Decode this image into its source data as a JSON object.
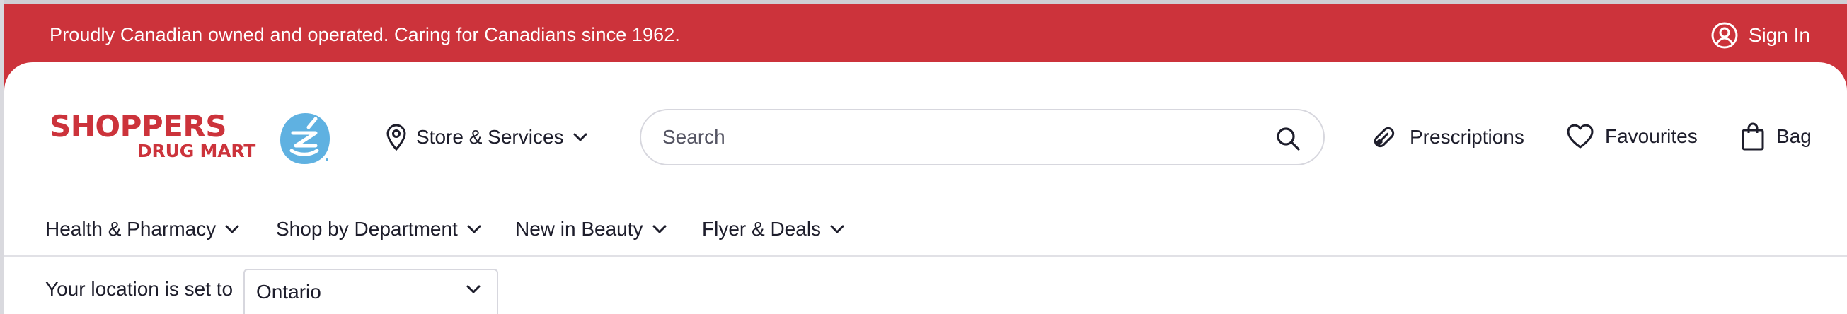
{
  "banner": {
    "message": "Proudly Canadian owned and operated. Caring for Canadians since 1962.",
    "sign_in_label": "Sign In"
  },
  "logo": {
    "line1": "SHOPPERS",
    "line2": "DRUG MART"
  },
  "header": {
    "store_services_label": "Store & Services",
    "search_placeholder": "Search",
    "prescriptions_label": "Prescriptions",
    "favourites_label": "Favourites",
    "bag_label": "Bag"
  },
  "main_nav": {
    "items": [
      {
        "label": "Health & Pharmacy"
      },
      {
        "label": "Shop by Department"
      },
      {
        "label": "New in Beauty"
      },
      {
        "label": "Flyer & Deals"
      }
    ]
  },
  "location": {
    "label": "Your location is set to",
    "selected": "Ontario"
  },
  "colors": {
    "brand_red": "#cc333b",
    "logo_blue": "#5fb1e1",
    "text_dark": "#1d1d2b"
  },
  "icons": {
    "sign_in": "user-circle-icon",
    "store": "map-pin-icon",
    "search": "search-icon",
    "prescriptions": "pill-icon",
    "favourites": "heart-icon",
    "bag": "shopping-bag-icon",
    "chevron": "chevron-down-icon"
  }
}
